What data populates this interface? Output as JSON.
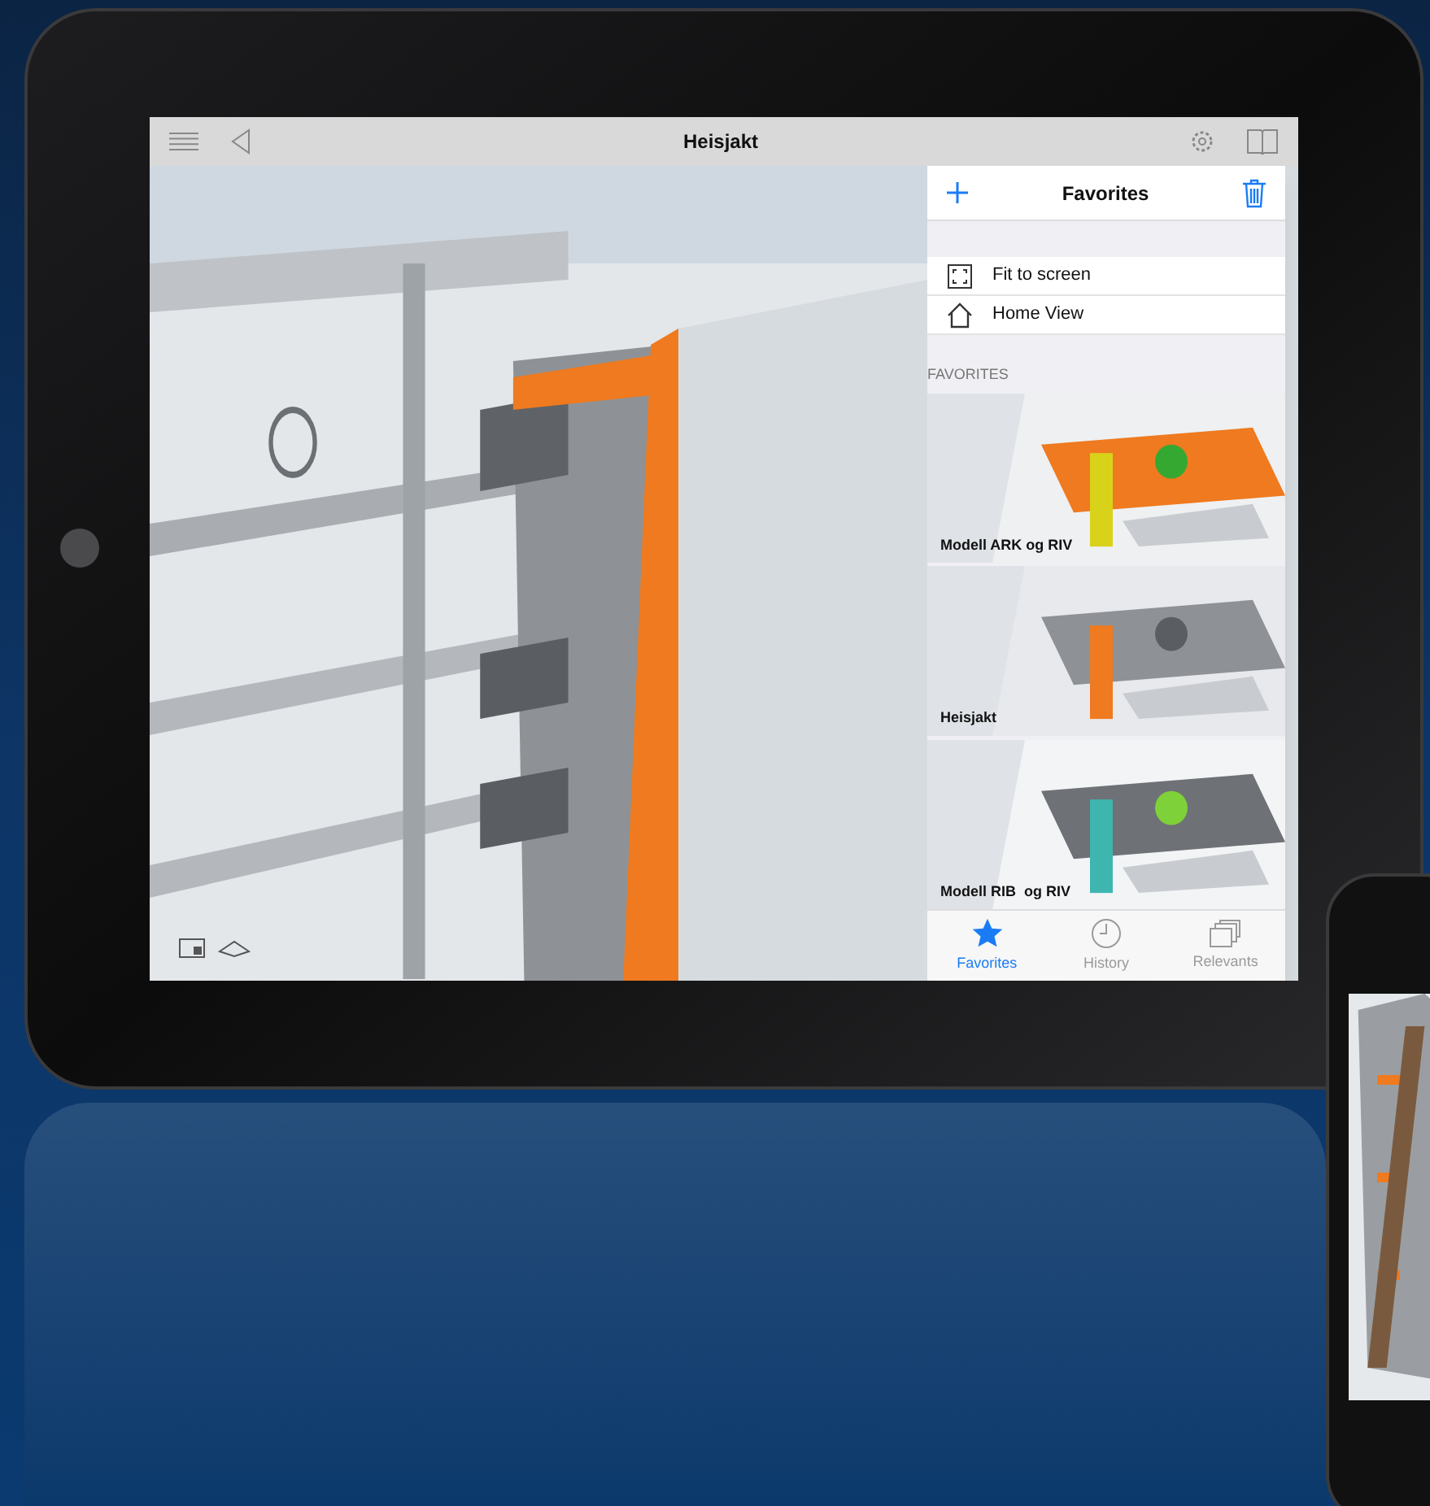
{
  "toolbar": {
    "title": "Heisjakt"
  },
  "favorites_panel": {
    "title": "Favorites",
    "actions": [
      {
        "label": "Fit to screen",
        "kind": "fit"
      },
      {
        "label": "Home View",
        "kind": "home"
      }
    ],
    "section_label": "FAVORITES",
    "favorites": [
      {
        "name": "Modell ARK og RIV"
      },
      {
        "name": "Heisjakt"
      },
      {
        "name": "Modell RIB  og RIV"
      }
    ],
    "tabs": [
      {
        "label": "Favorites",
        "selected": true,
        "kind": "star"
      },
      {
        "label": "History",
        "selected": false,
        "kind": "clock"
      },
      {
        "label": "Relevants",
        "selected": false,
        "kind": "stack"
      }
    ]
  }
}
